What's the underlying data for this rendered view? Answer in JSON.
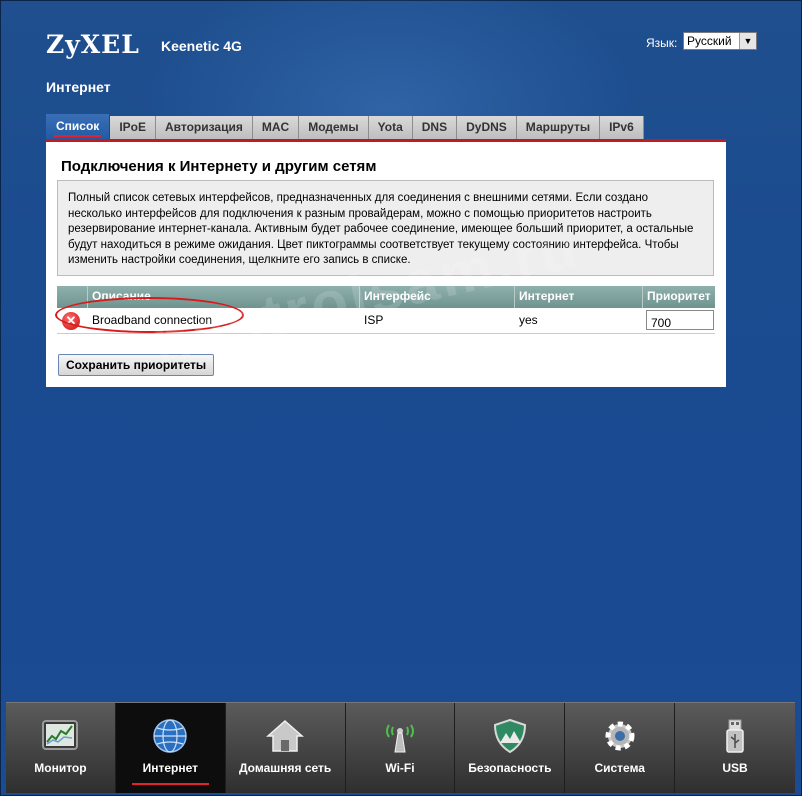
{
  "header": {
    "brand": "ZyXEL",
    "model": "Keenetic 4G",
    "language_label": "Язык:",
    "language_value": "Русский"
  },
  "page_title": "Интернет",
  "tabs": [
    {
      "label": "Список",
      "active": true
    },
    {
      "label": "IPoE"
    },
    {
      "label": "Авторизация"
    },
    {
      "label": "MAC"
    },
    {
      "label": "Модемы"
    },
    {
      "label": "Yota"
    },
    {
      "label": "DNS"
    },
    {
      "label": "DyDNS"
    },
    {
      "label": "Маршруты"
    },
    {
      "label": "IPv6"
    }
  ],
  "panel": {
    "title": "Подключения к Интернету и другим сетям",
    "description": "Полный список сетевых интерфейсов, предназначенных для соединения с внешними сетями. Если создано несколько интерфейсов для подключения к разным провайдерам, можно с помощью приоритетов настроить резервирование интернет-канала. Активным будет рабочее соединение, имеющее больший приоритет, а остальные будут находиться в режиме ожидания. Цвет пиктограммы соответствует текущему состоянию интерфейса. Чтобы изменить настройки соединения, щелкните его запись в списке.",
    "columns": [
      "Описание",
      "Интерфейс",
      "Интернет",
      "Приоритет"
    ],
    "rows": [
      {
        "status_icon": "error-x-icon",
        "description": "Broadband connection",
        "interface": "ISP",
        "internet": "yes",
        "priority": "700"
      }
    ],
    "save_button": "Сохранить приоритеты"
  },
  "watermark": "nastroisam.ru",
  "bottom_nav": [
    {
      "label": "Монитор",
      "icon": "monitor-chart-icon"
    },
    {
      "label": "Интернет",
      "icon": "globe-icon",
      "active": true
    },
    {
      "label": "Домашняя сеть",
      "icon": "house-icon"
    },
    {
      "label": "Wi-Fi",
      "icon": "wifi-antenna-icon"
    },
    {
      "label": "Безопасность",
      "icon": "shield-icon"
    },
    {
      "label": "Система",
      "icon": "gear-icon"
    },
    {
      "label": "USB",
      "icon": "usb-icon"
    }
  ],
  "colors": {
    "accent_red": "#e0242a",
    "tab_active": "#215aa4",
    "grid_header": "#7b9d99",
    "background": "#1b4c8f"
  }
}
